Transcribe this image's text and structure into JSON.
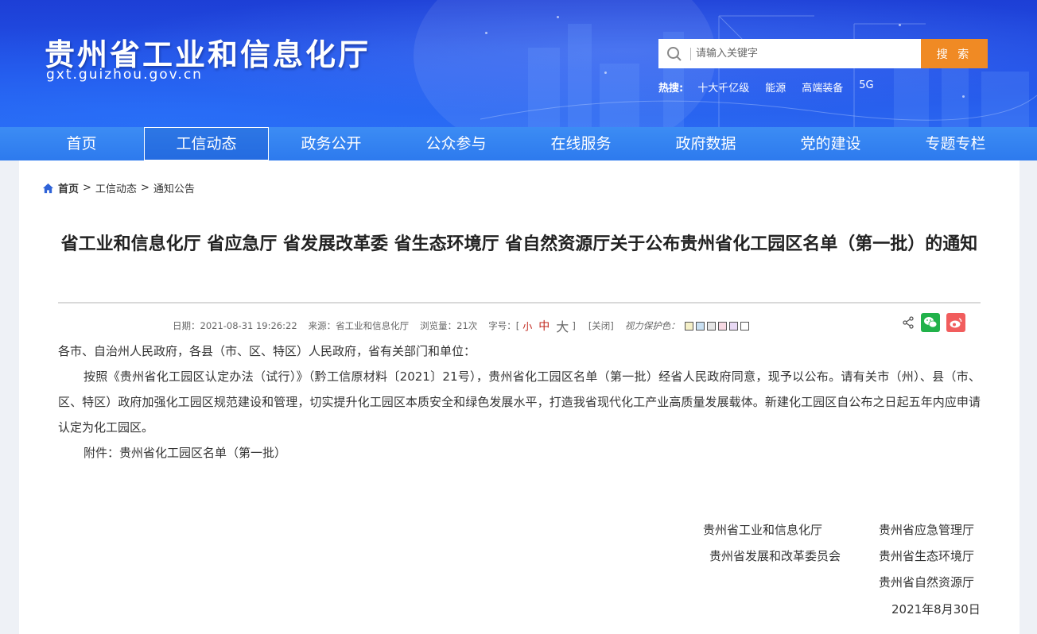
{
  "header": {
    "site_title": "贵州省工业和信息化厅",
    "site_domain": "gxt.guizhou.gov.cn",
    "search_placeholder": "请输入关键字",
    "search_button": "搜 索",
    "hot_label": "热搜:",
    "hot_items": [
      "十大千亿级",
      "能源",
      "高端装备",
      "5G"
    ]
  },
  "nav": {
    "items": [
      "首页",
      "工信动态",
      "政务公开",
      "公众参与",
      "在线服务",
      "政府数据",
      "党的建设",
      "专题专栏"
    ],
    "active": "工信动态"
  },
  "breadcrumb": [
    "首页",
    "工信动态",
    "通知公告"
  ],
  "article": {
    "title": "省工业和信息化厅 省应急厅 省发展改革委 省生态环境厅 省自然资源厅关于公布贵州省化工园区名单（第一批）的通知",
    "meta": {
      "date": "日期：2021-08-31 19:26:22",
      "source": "来源：省工业和信息化厅",
      "views": "浏览量：21次",
      "font_size_label": "字号：[",
      "font_small": "小",
      "font_medium": "中",
      "font_large": "大",
      "font_close_bracket": "]",
      "close": "[关闭]",
      "eye_label": "视力保护色：",
      "swatches": [
        "#f5f0c8",
        "#c9e0f2",
        "#e6e6e6",
        "#f7d9e3",
        "#e9d9f5",
        "#ffffff"
      ]
    },
    "salutation": "各市、自治州人民政府，各县（市、区、特区）人民政府，省有关部门和单位：",
    "paragraph": "按照《贵州省化工园区认定办法（试行）》（黔工信原材料〔2021〕21号），贵州省化工园区名单（第一批）经省人民政府同意，现予以公布。请有关市（州）、县（市、区、特区）政府加强化工园区规范建设和管理，切实提升化工园区本质安全和绿色发展水平，打造我省现代化工产业高质量发展载体。新建化工园区自公布之日起五年内应申请认定为化工园区。",
    "attachment": "附件：贵州省化工园区名单（第一批）",
    "signatures": {
      "s1": "贵州省工业和信息化厅",
      "s2": "贵州省应急管理厅",
      "s3": "贵州省发展和改革委员会",
      "s4": "贵州省生态环境厅",
      "s5": "贵州省自然资源厅",
      "date": "2021年8月30日"
    }
  }
}
